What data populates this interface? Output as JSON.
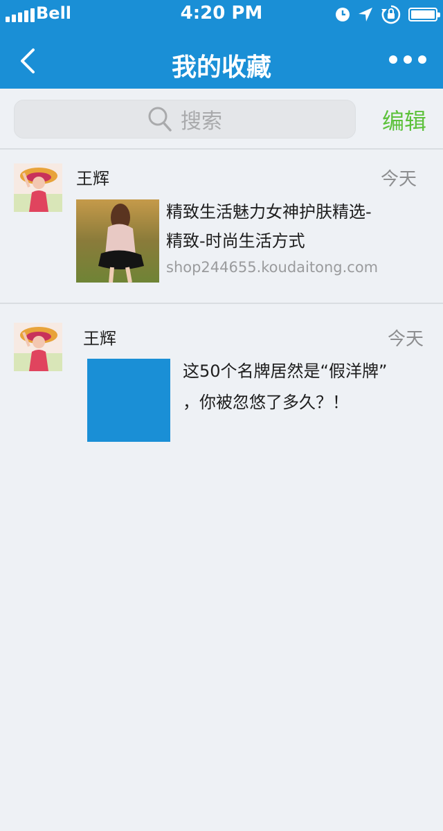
{
  "status_bar": {
    "carrier": "Bell",
    "time": "4:20 PM"
  },
  "nav": {
    "title": "我的收藏"
  },
  "search": {
    "placeholder": "搜索",
    "edit_label": "编辑"
  },
  "favorites": [
    {
      "user": "王辉",
      "date": "今天",
      "title_line1": "精致生活魅力女神护肤精选-",
      "title_line2": "精致-时尚生活方式",
      "url": "shop244655.koudaitong.com"
    },
    {
      "user": "王辉",
      "date": "今天",
      "title_line1": "这50个名牌居然是“假洋牌”",
      "title_line2": "，你被忽悠了多久？！"
    }
  ],
  "colors": {
    "header_bg": "#1a8fd6",
    "page_bg": "#eef1f5",
    "edit_green": "#5cc13a",
    "placeholder_thumb": "#1a8fd6"
  }
}
